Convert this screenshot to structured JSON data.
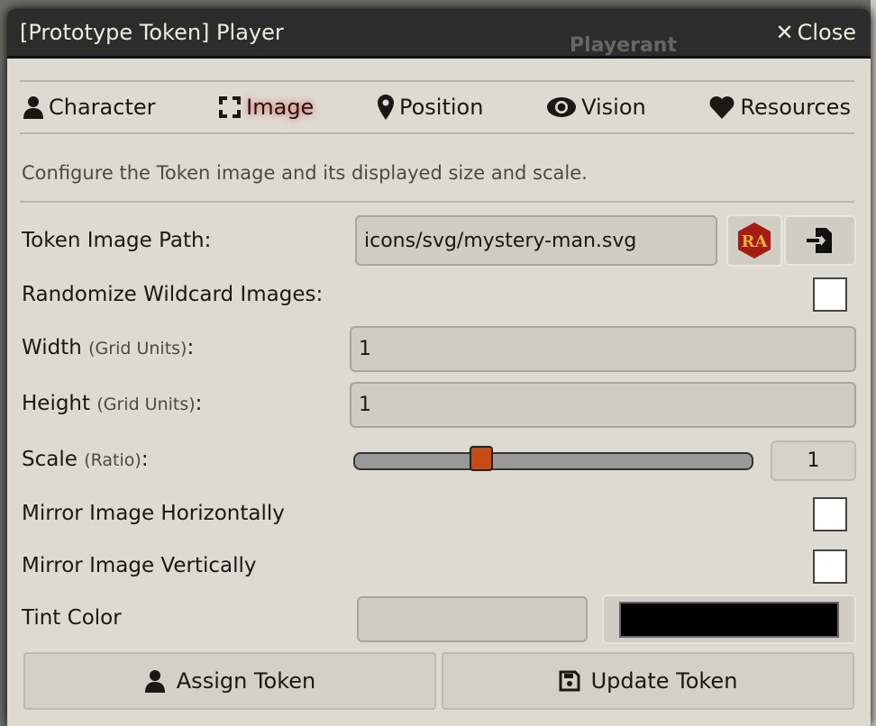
{
  "window": {
    "title": "[Prototype Token] Player",
    "close_label": "Close",
    "background_text": "Playerant"
  },
  "tabs": [
    {
      "label": "Character",
      "icon": "user-icon"
    },
    {
      "label": "Image",
      "icon": "frame-icon",
      "active": true
    },
    {
      "label": "Position",
      "icon": "map-marker-icon"
    },
    {
      "label": "Vision",
      "icon": "eye-icon"
    },
    {
      "label": "Resources",
      "icon": "heart-icon"
    }
  ],
  "description": "Configure the Token image and its displayed size and scale.",
  "fields": {
    "image_path": {
      "label": "Token Image Path:",
      "value": "icons/svg/mystery-man.svg"
    },
    "randomize": {
      "label": "Randomize Wildcard Images:",
      "checked": false
    },
    "width": {
      "label": "Width",
      "unit": "(Grid Units)",
      "colon": ":",
      "value": "1"
    },
    "height": {
      "label": "Height",
      "unit": "(Grid Units)",
      "colon": ":",
      "value": "1"
    },
    "scale": {
      "label": "Scale",
      "unit": "(Ratio)",
      "colon": ":",
      "value": "1",
      "slider_fraction": 0.3
    },
    "mirror_x": {
      "label": "Mirror Image Horizontally",
      "checked": false
    },
    "mirror_y": {
      "label": "Mirror Image Vertically",
      "checked": false
    },
    "tint": {
      "label": "Tint Color",
      "value": "",
      "color": "#000000"
    }
  },
  "logo_text": "RA",
  "buttons": {
    "assign": "Assign Token",
    "update": "Update Token"
  }
}
